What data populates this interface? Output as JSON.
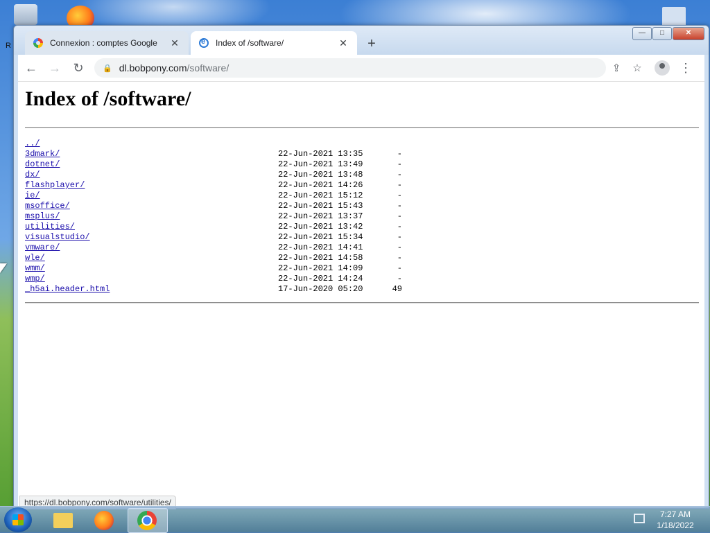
{
  "desktop": {
    "side_letter": "R"
  },
  "browser": {
    "tabs": [
      {
        "label": "Connexion : comptes Google",
        "active": false,
        "icon": "google-icon"
      },
      {
        "label": "Index of /software/",
        "active": true,
        "icon": "ie-page-icon"
      }
    ],
    "window_controls": {
      "minimize": "—",
      "maximize": "□",
      "close": "✕"
    },
    "address": {
      "host": "dl.bobpony.com",
      "path": "/software/"
    }
  },
  "page": {
    "title": "Index of /software/",
    "entries": [
      {
        "name": "../",
        "date": "",
        "size": ""
      },
      {
        "name": "3dmark/",
        "date": "22-Jun-2021 13:35",
        "size": "-"
      },
      {
        "name": "dotnet/",
        "date": "22-Jun-2021 13:49",
        "size": "-"
      },
      {
        "name": "dx/",
        "date": "22-Jun-2021 13:48",
        "size": "-"
      },
      {
        "name": "flashplayer/",
        "date": "22-Jun-2021 14:26",
        "size": "-"
      },
      {
        "name": "ie/",
        "date": "22-Jun-2021 15:12",
        "size": "-"
      },
      {
        "name": "msoffice/",
        "date": "22-Jun-2021 15:43",
        "size": "-"
      },
      {
        "name": "msplus/",
        "date": "22-Jun-2021 13:37",
        "size": "-"
      },
      {
        "name": "utilities/",
        "date": "22-Jun-2021 13:42",
        "size": "-"
      },
      {
        "name": "visualstudio/",
        "date": "22-Jun-2021 15:34",
        "size": "-"
      },
      {
        "name": "vmware/",
        "date": "22-Jun-2021 14:41",
        "size": "-"
      },
      {
        "name": "wle/",
        "date": "22-Jun-2021 14:58",
        "size": "-"
      },
      {
        "name": "wmm/",
        "date": "22-Jun-2021 14:09",
        "size": "-"
      },
      {
        "name": "wmp/",
        "date": "22-Jun-2021 14:24",
        "size": "-"
      },
      {
        "name": "_h5ai.header.html",
        "date": "17-Jun-2020 05:20",
        "size": "49"
      }
    ]
  },
  "status_bar": "https://dl.bobpony.com/software/utilities/",
  "taskbar": {
    "apps": [
      "windows-explorer-icon",
      "firefox-icon",
      "chrome-icon"
    ],
    "clock": {
      "time": "7:27 AM",
      "date": "1/18/2022"
    }
  }
}
